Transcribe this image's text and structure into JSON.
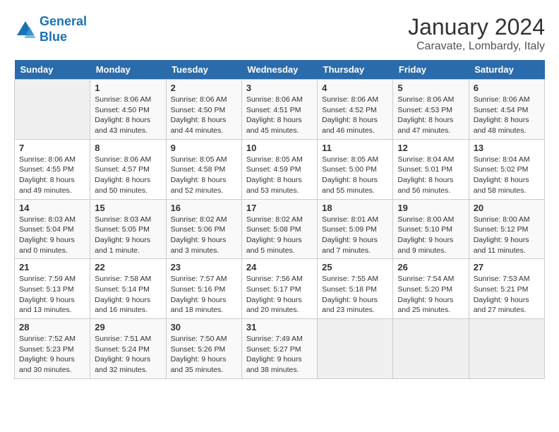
{
  "header": {
    "logo_line1": "General",
    "logo_line2": "Blue",
    "month": "January 2024",
    "location": "Caravate, Lombardy, Italy"
  },
  "weekdays": [
    "Sunday",
    "Monday",
    "Tuesday",
    "Wednesday",
    "Thursday",
    "Friday",
    "Saturday"
  ],
  "weeks": [
    [
      {
        "day": "",
        "info": ""
      },
      {
        "day": "1",
        "info": "Sunrise: 8:06 AM\nSunset: 4:50 PM\nDaylight: 8 hours\nand 43 minutes."
      },
      {
        "day": "2",
        "info": "Sunrise: 8:06 AM\nSunset: 4:50 PM\nDaylight: 8 hours\nand 44 minutes."
      },
      {
        "day": "3",
        "info": "Sunrise: 8:06 AM\nSunset: 4:51 PM\nDaylight: 8 hours\nand 45 minutes."
      },
      {
        "day": "4",
        "info": "Sunrise: 8:06 AM\nSunset: 4:52 PM\nDaylight: 8 hours\nand 46 minutes."
      },
      {
        "day": "5",
        "info": "Sunrise: 8:06 AM\nSunset: 4:53 PM\nDaylight: 8 hours\nand 47 minutes."
      },
      {
        "day": "6",
        "info": "Sunrise: 8:06 AM\nSunset: 4:54 PM\nDaylight: 8 hours\nand 48 minutes."
      }
    ],
    [
      {
        "day": "7",
        "info": "Sunrise: 8:06 AM\nSunset: 4:55 PM\nDaylight: 8 hours\nand 49 minutes."
      },
      {
        "day": "8",
        "info": "Sunrise: 8:06 AM\nSunset: 4:57 PM\nDaylight: 8 hours\nand 50 minutes."
      },
      {
        "day": "9",
        "info": "Sunrise: 8:05 AM\nSunset: 4:58 PM\nDaylight: 8 hours\nand 52 minutes."
      },
      {
        "day": "10",
        "info": "Sunrise: 8:05 AM\nSunset: 4:59 PM\nDaylight: 8 hours\nand 53 minutes."
      },
      {
        "day": "11",
        "info": "Sunrise: 8:05 AM\nSunset: 5:00 PM\nDaylight: 8 hours\nand 55 minutes."
      },
      {
        "day": "12",
        "info": "Sunrise: 8:04 AM\nSunset: 5:01 PM\nDaylight: 8 hours\nand 56 minutes."
      },
      {
        "day": "13",
        "info": "Sunrise: 8:04 AM\nSunset: 5:02 PM\nDaylight: 8 hours\nand 58 minutes."
      }
    ],
    [
      {
        "day": "14",
        "info": "Sunrise: 8:03 AM\nSunset: 5:04 PM\nDaylight: 9 hours\nand 0 minutes."
      },
      {
        "day": "15",
        "info": "Sunrise: 8:03 AM\nSunset: 5:05 PM\nDaylight: 9 hours\nand 1 minute."
      },
      {
        "day": "16",
        "info": "Sunrise: 8:02 AM\nSunset: 5:06 PM\nDaylight: 9 hours\nand 3 minutes."
      },
      {
        "day": "17",
        "info": "Sunrise: 8:02 AM\nSunset: 5:08 PM\nDaylight: 9 hours\nand 5 minutes."
      },
      {
        "day": "18",
        "info": "Sunrise: 8:01 AM\nSunset: 5:09 PM\nDaylight: 9 hours\nand 7 minutes."
      },
      {
        "day": "19",
        "info": "Sunrise: 8:00 AM\nSunset: 5:10 PM\nDaylight: 9 hours\nand 9 minutes."
      },
      {
        "day": "20",
        "info": "Sunrise: 8:00 AM\nSunset: 5:12 PM\nDaylight: 9 hours\nand 11 minutes."
      }
    ],
    [
      {
        "day": "21",
        "info": "Sunrise: 7:59 AM\nSunset: 5:13 PM\nDaylight: 9 hours\nand 13 minutes."
      },
      {
        "day": "22",
        "info": "Sunrise: 7:58 AM\nSunset: 5:14 PM\nDaylight: 9 hours\nand 16 minutes."
      },
      {
        "day": "23",
        "info": "Sunrise: 7:57 AM\nSunset: 5:16 PM\nDaylight: 9 hours\nand 18 minutes."
      },
      {
        "day": "24",
        "info": "Sunrise: 7:56 AM\nSunset: 5:17 PM\nDaylight: 9 hours\nand 20 minutes."
      },
      {
        "day": "25",
        "info": "Sunrise: 7:55 AM\nSunset: 5:18 PM\nDaylight: 9 hours\nand 23 minutes."
      },
      {
        "day": "26",
        "info": "Sunrise: 7:54 AM\nSunset: 5:20 PM\nDaylight: 9 hours\nand 25 minutes."
      },
      {
        "day": "27",
        "info": "Sunrise: 7:53 AM\nSunset: 5:21 PM\nDaylight: 9 hours\nand 27 minutes."
      }
    ],
    [
      {
        "day": "28",
        "info": "Sunrise: 7:52 AM\nSunset: 5:23 PM\nDaylight: 9 hours\nand 30 minutes."
      },
      {
        "day": "29",
        "info": "Sunrise: 7:51 AM\nSunset: 5:24 PM\nDaylight: 9 hours\nand 32 minutes."
      },
      {
        "day": "30",
        "info": "Sunrise: 7:50 AM\nSunset: 5:26 PM\nDaylight: 9 hours\nand 35 minutes."
      },
      {
        "day": "31",
        "info": "Sunrise: 7:49 AM\nSunset: 5:27 PM\nDaylight: 9 hours\nand 38 minutes."
      },
      {
        "day": "",
        "info": ""
      },
      {
        "day": "",
        "info": ""
      },
      {
        "day": "",
        "info": ""
      }
    ]
  ]
}
